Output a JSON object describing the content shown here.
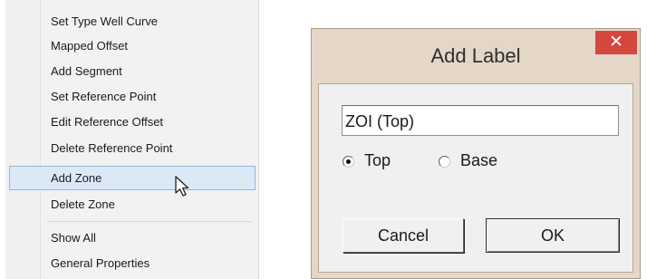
{
  "context_menu": {
    "items": [
      {
        "label": "Set Type Well Curve"
      },
      {
        "label": "Mapped Offset"
      },
      {
        "label": "Add Segment"
      },
      {
        "label": "Set Reference Point"
      },
      {
        "label": "Edit Reference Offset"
      },
      {
        "label": "Delete Reference Point"
      },
      {
        "label": "Add Zone",
        "highlighted": true
      },
      {
        "label": "Delete Zone"
      },
      {
        "label": "Show All"
      },
      {
        "label": "General Properties"
      }
    ]
  },
  "dialog": {
    "title": "Add Label",
    "close_glyph": "✕",
    "label_value": "ZOI (Top)",
    "radio_top_label": "Top",
    "radio_base_label": "Base",
    "selected_option": "Top",
    "cancel_label": "Cancel",
    "ok_label": "OK"
  },
  "colors": {
    "highlight_bg": "#dbe9f7",
    "close_button": "#d6473e",
    "dialog_frame": "#e4d7c8"
  }
}
